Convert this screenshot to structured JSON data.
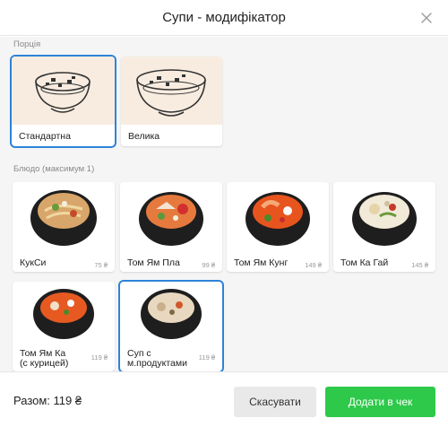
{
  "modal": {
    "title": "Супи - модифікатор",
    "close_icon": "close-icon"
  },
  "portion": {
    "label": "Порція",
    "options": [
      {
        "name": "Стандартна",
        "selected": true,
        "icon": "small-soup-bowl-icon"
      },
      {
        "name": "Велика",
        "selected": false,
        "icon": "large-soup-bowl-icon"
      }
    ]
  },
  "dish": {
    "label": "Блюдо (максимум 1)",
    "items": [
      {
        "name": "КукСи",
        "price": "75 ₴",
        "selected": false
      },
      {
        "name": "Том Ям Пла",
        "price": "99 ₴",
        "selected": false
      },
      {
        "name": "Том Ям Кунг",
        "price": "149 ₴",
        "selected": false
      },
      {
        "name": "Том Ка Гай",
        "price": "145 ₴",
        "selected": false
      },
      {
        "name": "Том Ям Ка",
        "name2": "(с курицей)",
        "price": "119 ₴",
        "selected": false
      },
      {
        "name": "Суп с",
        "name2": "м.продуктами",
        "price": "119 ₴",
        "selected": true
      }
    ]
  },
  "footer": {
    "total": "Разом: 119 ₴",
    "cancel_label": "Скасувати",
    "add_label": "Додати в чек"
  },
  "colors": {
    "accent": "#2d83d8",
    "confirm": "#2ec94a",
    "background": "#f5f5f5"
  }
}
